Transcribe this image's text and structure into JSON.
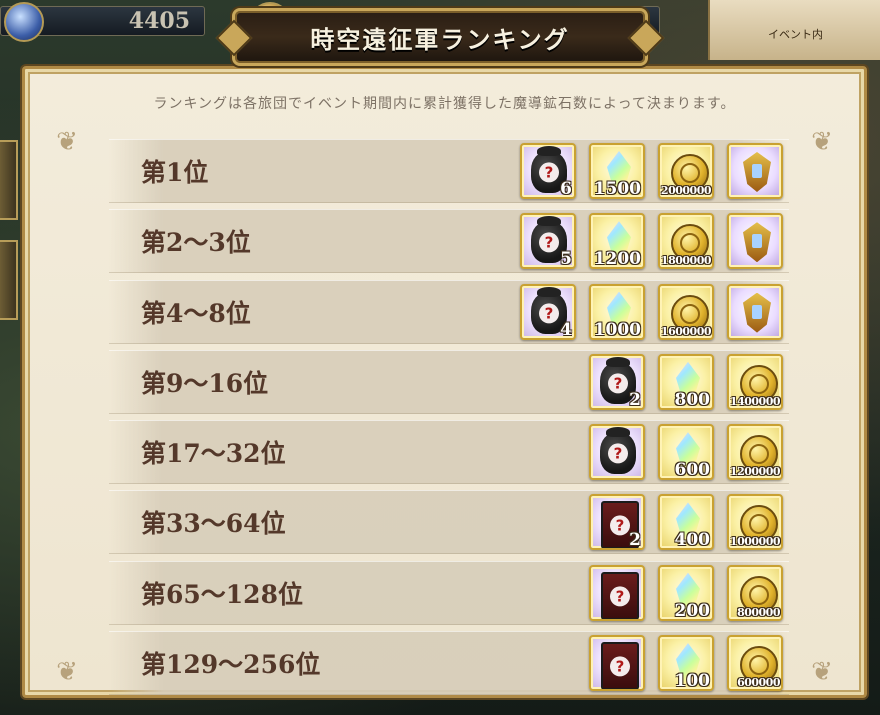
{
  "hud": {
    "resource_1_value": "4405",
    "resource_2_value": "",
    "resource_3_value": "",
    "event_tab_label": "イベント内"
  },
  "panel": {
    "title": "時空遠征軍ランキング",
    "subtitle": "ランキングは各旅団でイベント期間内に累計獲得した魔導鉱石数によって決まります。"
  },
  "rankings": [
    {
      "label": "第1位",
      "rewards": [
        {
          "icon": "bag-mystery-icon",
          "bg": "purple",
          "qty": "6"
        },
        {
          "icon": "crystal-icon",
          "bg": "yellow",
          "qty": "1500"
        },
        {
          "icon": "gold-coin-icon",
          "bg": "yellow",
          "qty": "2000000"
        },
        {
          "icon": "medal-emblem-icon",
          "bg": "lavender",
          "qty": ""
        }
      ]
    },
    {
      "label": "第2〜3位",
      "rewards": [
        {
          "icon": "bag-mystery-icon",
          "bg": "purple",
          "qty": "5"
        },
        {
          "icon": "crystal-icon",
          "bg": "yellow",
          "qty": "1200"
        },
        {
          "icon": "gold-coin-icon",
          "bg": "yellow",
          "qty": "1800000"
        },
        {
          "icon": "medal-emblem-icon",
          "bg": "lavender",
          "qty": ""
        }
      ]
    },
    {
      "label": "第4〜8位",
      "rewards": [
        {
          "icon": "bag-mystery-icon",
          "bg": "purple",
          "qty": "4"
        },
        {
          "icon": "crystal-icon",
          "bg": "yellow",
          "qty": "1000"
        },
        {
          "icon": "gold-coin-icon",
          "bg": "yellow",
          "qty": "1600000"
        },
        {
          "icon": "medal-emblem-icon",
          "bg": "lavender",
          "qty": ""
        }
      ]
    },
    {
      "label": "第9〜16位",
      "rewards": [
        {
          "icon": "bag-mystery-icon",
          "bg": "purple",
          "qty": "2"
        },
        {
          "icon": "crystal-icon",
          "bg": "yellow",
          "qty": "800"
        },
        {
          "icon": "gold-coin-icon",
          "bg": "yellow",
          "qty": "1400000"
        }
      ]
    },
    {
      "label": "第17〜32位",
      "rewards": [
        {
          "icon": "bag-mystery-icon",
          "bg": "purple",
          "qty": ""
        },
        {
          "icon": "crystal-icon",
          "bg": "yellow",
          "qty": "600"
        },
        {
          "icon": "gold-coin-icon",
          "bg": "yellow",
          "qty": "1200000"
        }
      ]
    },
    {
      "label": "第33〜64位",
      "rewards": [
        {
          "icon": "scroll-mystery-icon",
          "bg": "purple",
          "qty": "2"
        },
        {
          "icon": "crystal-icon",
          "bg": "yellow",
          "qty": "400"
        },
        {
          "icon": "gold-coin-icon",
          "bg": "yellow",
          "qty": "1000000"
        }
      ]
    },
    {
      "label": "第65〜128位",
      "rewards": [
        {
          "icon": "scroll-mystery-icon",
          "bg": "purple",
          "qty": ""
        },
        {
          "icon": "crystal-icon",
          "bg": "yellow",
          "qty": "200"
        },
        {
          "icon": "gold-coin-icon",
          "bg": "yellow",
          "qty": "800000"
        }
      ]
    },
    {
      "label": "第129〜256位",
      "rewards": [
        {
          "icon": "scroll-mystery-icon",
          "bg": "purple",
          "qty": ""
        },
        {
          "icon": "crystal-icon",
          "bg": "yellow",
          "qty": "100"
        },
        {
          "icon": "gold-coin-icon",
          "bg": "yellow",
          "qty": "600000"
        }
      ]
    }
  ],
  "colors": {
    "panel_bg": "#f1e9d6",
    "frame_gold": "#b08a45",
    "rank_text": "#54382a",
    "subtitle_text": "#7d7265"
  }
}
